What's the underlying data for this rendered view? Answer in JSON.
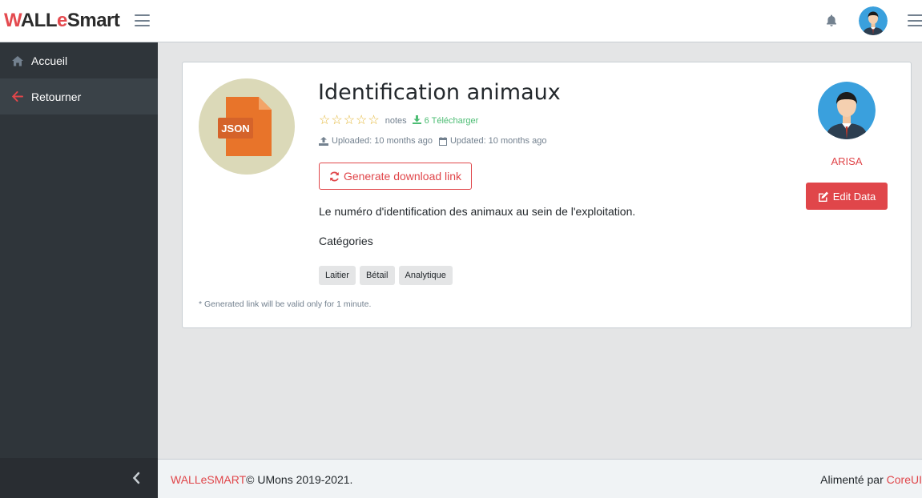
{
  "header": {
    "logo": {
      "part1": "W",
      "part2": "ALL",
      "part3": "e",
      "part4": "Smart"
    },
    "icons": [
      "hamburger-icon",
      "bell-icon",
      "user-avatar",
      "menu-icon"
    ]
  },
  "sidebar": {
    "items": [
      {
        "label": "Accueil",
        "icon": "home-icon"
      },
      {
        "label": "Retourner",
        "icon": "arrow-left-icon"
      }
    ]
  },
  "dataset": {
    "file_type": "JSON",
    "title": "Identification animaux",
    "notes_label": "notes",
    "download_label": "6 Télécharger",
    "uploaded": "Uploaded: 10 months ago",
    "updated": "Updated: 10 months ago",
    "generate_button": "Generate download link",
    "description": "Le numéro d'identification des animaux au sein de l'exploitation.",
    "categories_title": "Catégories",
    "tags": [
      "Laitier",
      "Bétail",
      "Analytique"
    ],
    "note": "* Generated link will be valid only for 1 minute.",
    "rating": 0,
    "rating_max": 5
  },
  "owner": {
    "name": "ARISA",
    "edit_button": "Edit Data"
  },
  "footer": {
    "brand": "WALLeSMART",
    "copyright": "© UMons 2019-2021.",
    "powered_by": "Alimenté par ",
    "powered_link": "CoreUI"
  },
  "colors": {
    "accent": "#e0464a",
    "sidebar": "#2f353a",
    "success": "#4dbd74",
    "star": "#e4b83b"
  }
}
